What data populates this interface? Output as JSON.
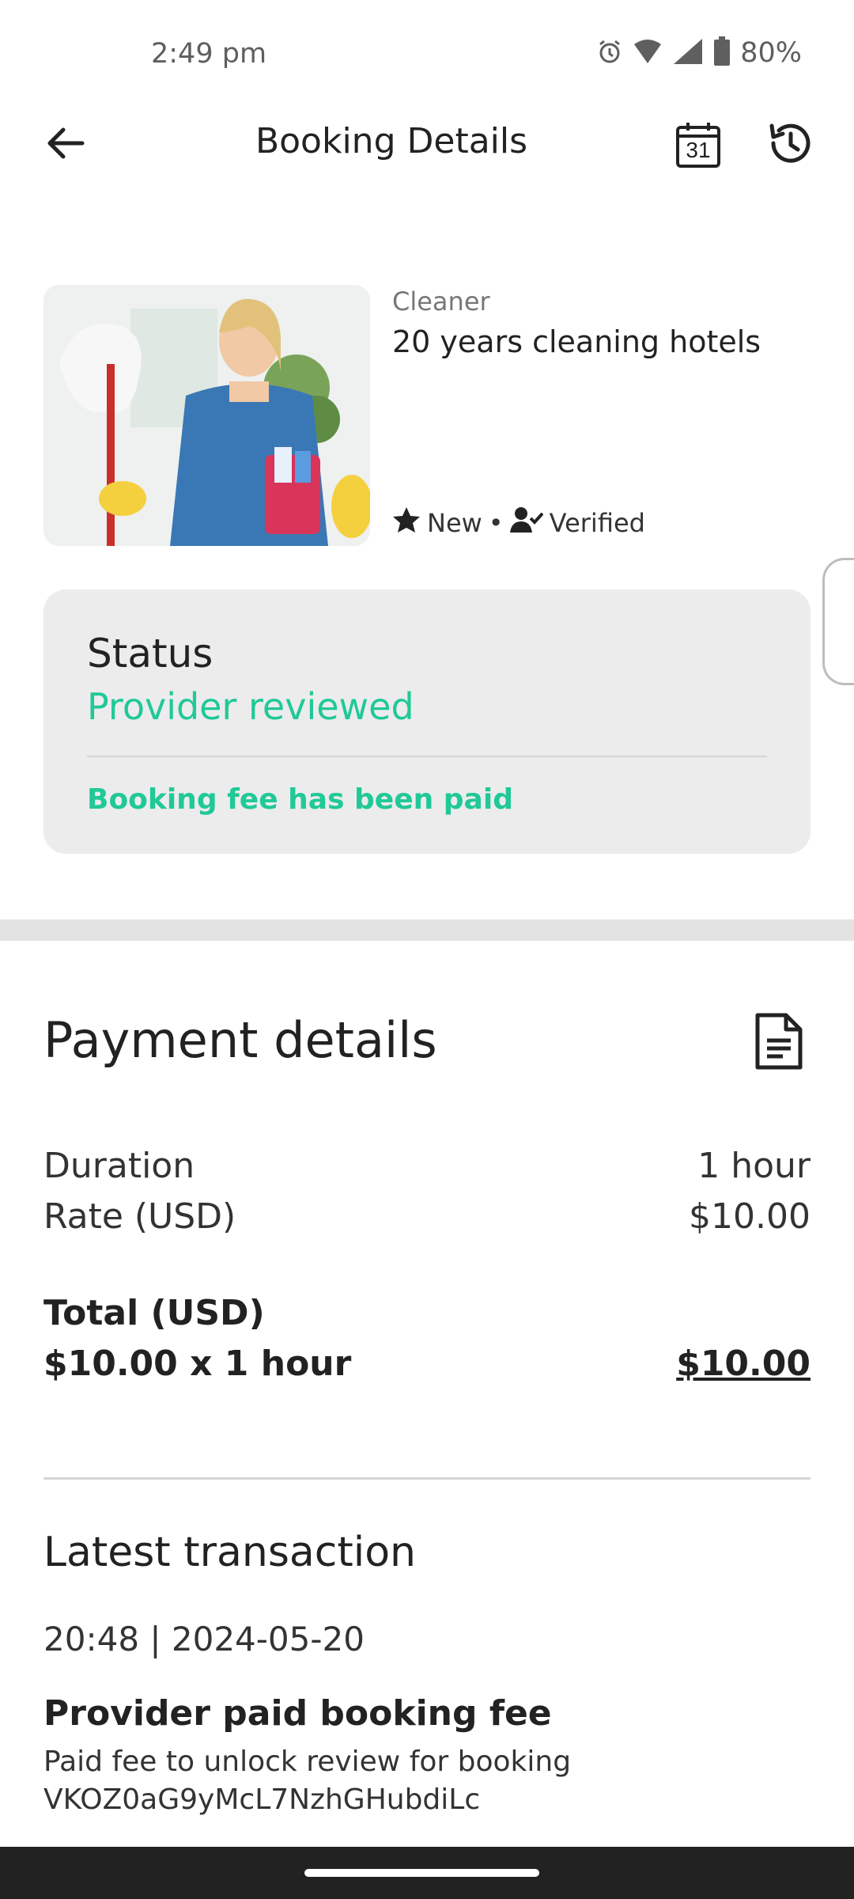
{
  "status_bar": {
    "time": "2:49 pm",
    "battery": "80%",
    "icons": [
      "alarm-icon",
      "wifi-icon",
      "signal-icon",
      "battery-icon"
    ]
  },
  "app_bar": {
    "title": "Booking Details",
    "calendar_day": "31",
    "icons": [
      "back-arrow-icon",
      "calendar-icon",
      "history-icon"
    ]
  },
  "provider": {
    "category": "Cleaner",
    "headline": "20 years cleaning hotels",
    "badge_new": "New",
    "separator": "•",
    "badge_verified": "Verified"
  },
  "status": {
    "title": "Status",
    "value": "Provider reviewed",
    "note": "Booking fee has been paid"
  },
  "payment": {
    "title": "Payment details",
    "rows": [
      {
        "label": "Duration",
        "value": "1 hour"
      },
      {
        "label": "Rate (USD)",
        "value": "$10.00"
      }
    ],
    "total_label": "Total (USD)",
    "total_formula": "$10.00 x 1 hour",
    "total_amount": "$10.00"
  },
  "transaction": {
    "title": "Latest transaction",
    "timestamp": "20:48 | 2024-05-20",
    "name": "Provider paid booking fee",
    "description_line1": "Paid fee to unlock review for booking",
    "description_line2": "VKOZ0aG9yMcL7NzhGHubdiLc"
  },
  "colors": {
    "accent_green": "#20c997",
    "card_bg": "#ececec"
  }
}
